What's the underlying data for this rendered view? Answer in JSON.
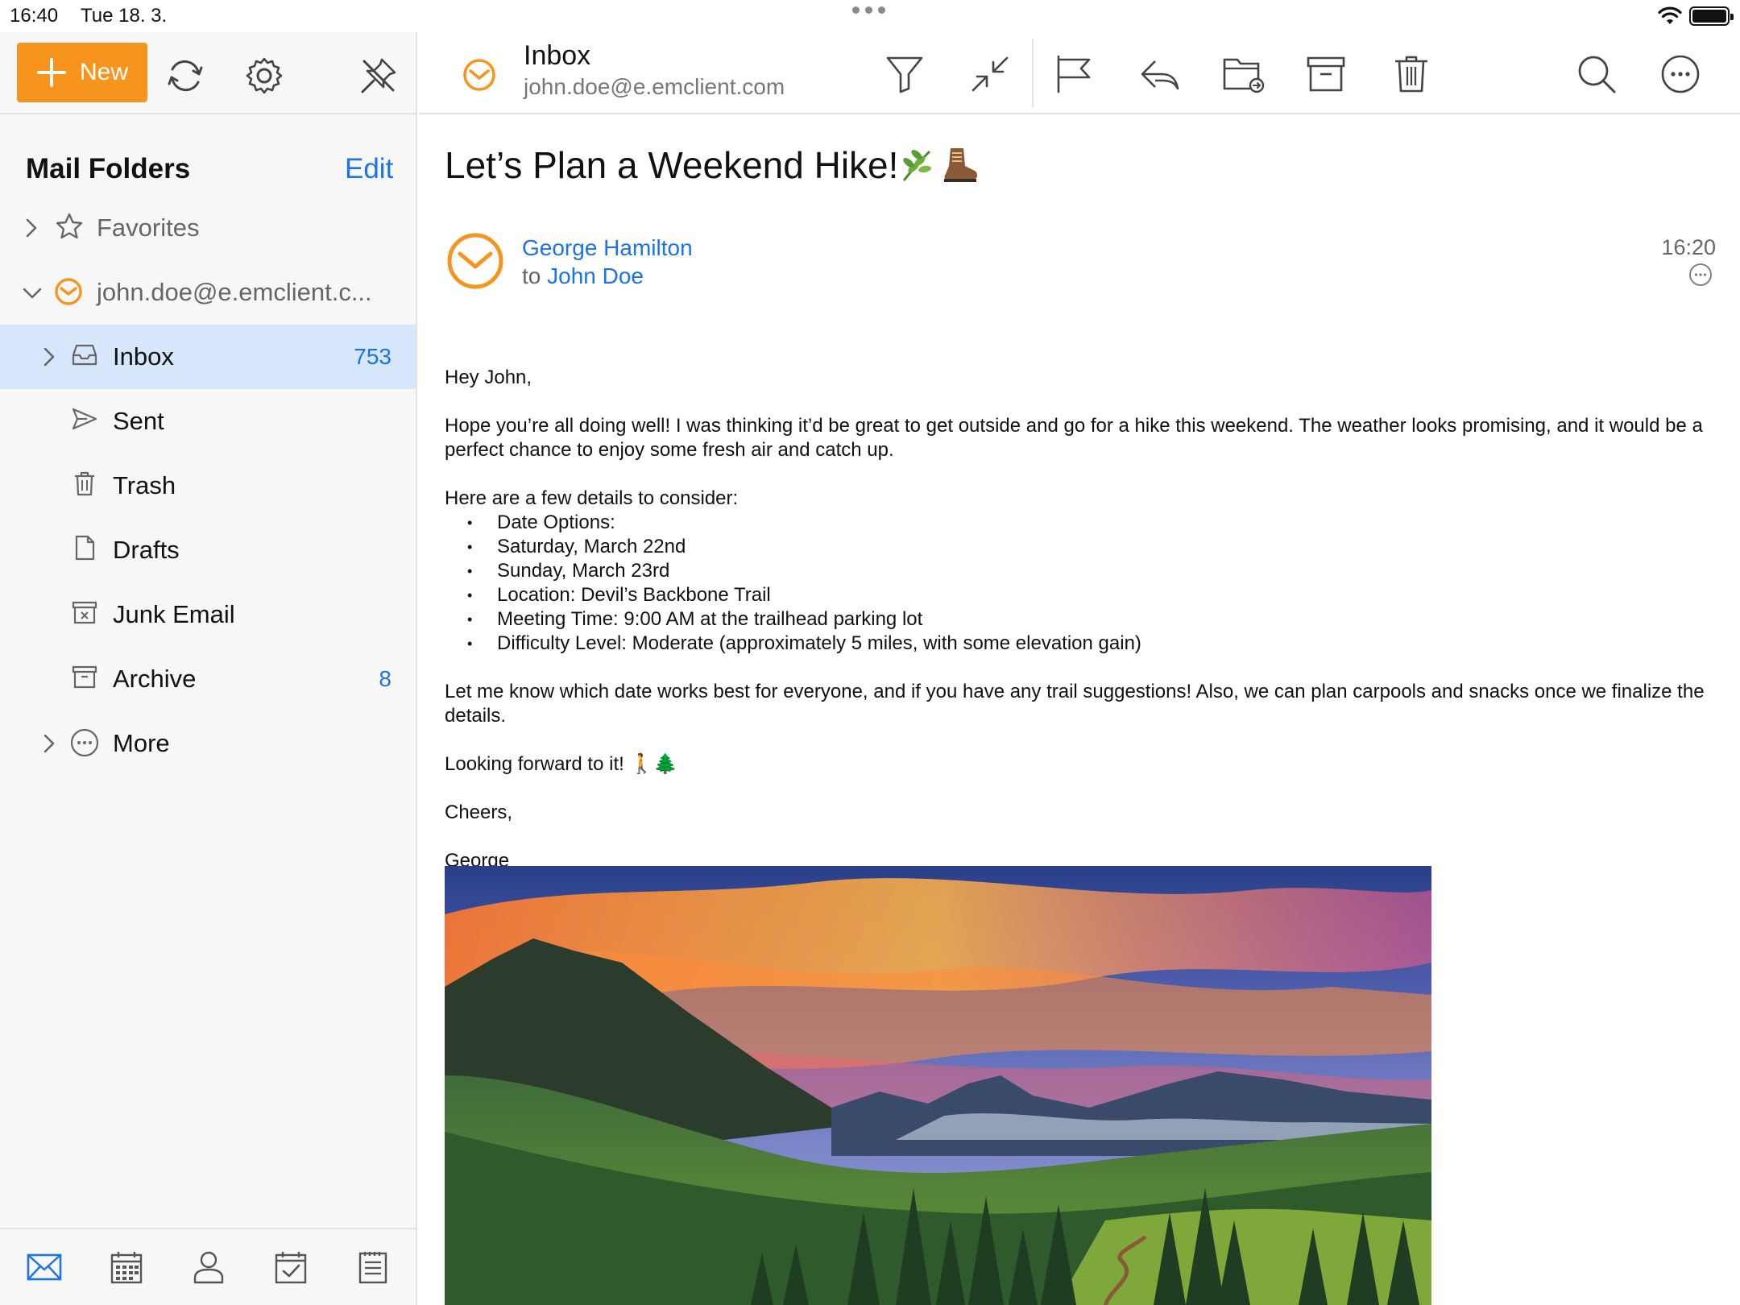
{
  "status": {
    "time": "16:40",
    "date": "Tue 18. 3."
  },
  "sidebar": {
    "new_label": "New",
    "title": "Mail Folders",
    "edit_label": "Edit",
    "favorites_label": "Favorites",
    "account_label": "john.doe@e.emclient.c...",
    "folders": [
      {
        "label": "Inbox",
        "count": "753",
        "icon": "inbox-icon"
      },
      {
        "label": "Sent",
        "count": "",
        "icon": "paper-plane-icon"
      },
      {
        "label": "Trash",
        "count": "",
        "icon": "trash-icon"
      },
      {
        "label": "Drafts",
        "count": "",
        "icon": "document-icon"
      },
      {
        "label": "Junk Email",
        "count": "",
        "icon": "junk-box-icon"
      },
      {
        "label": "Archive",
        "count": "8",
        "icon": "archive-box-icon"
      },
      {
        "label": "More",
        "count": "",
        "icon": "more-circle-icon"
      }
    ],
    "bottom_nav": [
      "mail-icon",
      "calendar-icon",
      "contacts-icon",
      "tasks-icon",
      "notes-icon"
    ]
  },
  "header": {
    "folder": "Inbox",
    "account": "john.doe@e.emclient.com"
  },
  "message": {
    "subject": "Let’s Plan a Weekend Hike!",
    "subject_emoji": "🌿🥾",
    "sender": "George Hamilton",
    "to_prefix": "to",
    "recipient": "John Doe",
    "time": "16:20",
    "greeting": "Hey John,",
    "para1": "Hope you’re all doing well! I was thinking it’d be great to get outside and go for a hike this weekend. The weather looks promising, and it would be a perfect chance to enjoy some fresh air and catch up.",
    "details_intro": "Here are a few details to consider:",
    "details": [
      "Date Options:",
      "Saturday, March 22nd",
      "Sunday, March 23rd",
      "Location: Devil’s Backbone Trail",
      "Meeting Time: 9:00 AM at the trailhead parking lot",
      "Difficulty Level: Moderate (approximately 5 miles, with some elevation gain)"
    ],
    "para2": "Let me know which date works best for everyone, and if you have any trail suggestions! Also, we can plan carpools and snacks once we finalize the details.",
    "closing_line": "Looking forward to it! 🚶🌲",
    "signoff": "Cheers,",
    "signature": "George"
  },
  "colors": {
    "accent_orange": "#f7941d",
    "link_blue": "#1a73e8",
    "selected_row": "#d6e6fb"
  }
}
